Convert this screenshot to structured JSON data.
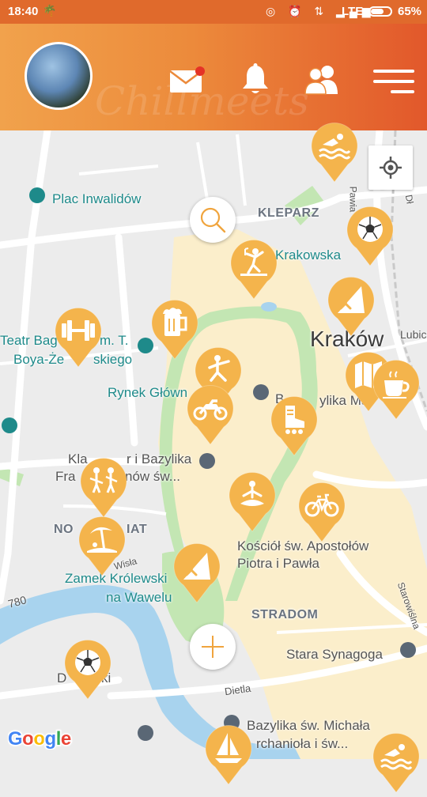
{
  "status_bar": {
    "time": "18:40",
    "network": "LTE",
    "battery_text": "65%",
    "battery_level": 0.65
  },
  "header": {
    "brand_watermark": "chillmeets",
    "mail_has_notification": true
  },
  "map": {
    "labels": {
      "plac_inwalidow": "Plac Inwalidów",
      "kleparz": "KLEPARZ",
      "krakowska": "Krakowska",
      "krakow": "Kraków",
      "lubicz": "Lubicz",
      "teatr_line1": "Teatr Bag",
      "teatr_line1b": "m. T.",
      "teatr_line2": "Boya-Że",
      "teatr_line2b": "skiego",
      "rynek": "Rynek Główn",
      "bazylika_mariacka": "B",
      "bazylika_mariacka_b": "ylika Ma",
      "klasztor_line1": "Kla",
      "klasztor_line1b": "r i Bazylika",
      "klasztor_line2": "Fra",
      "klasztor_line2b": "nów św...",
      "nowy_swiat_a": "NO",
      "nowy_swiat_b": "IAT",
      "kosciol_line1": "Kościół św. Apostołów",
      "kosciol_line2": "Piotra i Pawła",
      "zamek_line1": "Zamek Królewski",
      "zamek_line2": "na Wawelu",
      "wisla": "Wisła",
      "road_780": "780",
      "stradom": "STRADOM",
      "stara_synagoga": "Stara Synagoga",
      "starowislna": "Starowiślna",
      "dietla": "Dietla",
      "debniki": "D",
      "debniki_b": "ki",
      "bazylika_michala_line1": "Bazylika św. Michała",
      "bazylika_michala_line2": "rchanioła i św...",
      "pawia": "Pawia",
      "dluga": "Dł"
    },
    "attribution": "Google"
  },
  "pins": [
    {
      "id": "swimming",
      "icon": "swimming-icon"
    },
    {
      "id": "football",
      "icon": "football-icon"
    },
    {
      "id": "dance",
      "icon": "dance-icon"
    },
    {
      "id": "climbing",
      "icon": "climbing-icon"
    },
    {
      "id": "gym",
      "icon": "dumbbell-icon"
    },
    {
      "id": "beer",
      "icon": "beer-icon"
    },
    {
      "id": "martial_arts",
      "icon": "martial-arts-icon"
    },
    {
      "id": "map_guide",
      "icon": "map-icon"
    },
    {
      "id": "coffee",
      "icon": "coffee-icon"
    },
    {
      "id": "motorbike",
      "icon": "motorbike-icon"
    },
    {
      "id": "rollerblade",
      "icon": "rollerblade-icon"
    },
    {
      "id": "music",
      "icon": "music-band-icon"
    },
    {
      "id": "yoga",
      "icon": "yoga-icon"
    },
    {
      "id": "cycling",
      "icon": "bicycle-icon"
    },
    {
      "id": "beach",
      "icon": "beach-icon"
    },
    {
      "id": "climbing2",
      "icon": "climbing-icon"
    },
    {
      "id": "football2",
      "icon": "football-icon"
    },
    {
      "id": "sailing",
      "icon": "sailing-icon"
    },
    {
      "id": "swimming2",
      "icon": "swimming-icon"
    }
  ],
  "colors": {
    "pin": "#f4b44c",
    "header_start": "#f1a24c",
    "header_end": "#e2582b",
    "status_bar": "#e06a2c",
    "park": "#c3e6b3",
    "old_town": "#fbeecb",
    "river": "#a8d3ee"
  }
}
